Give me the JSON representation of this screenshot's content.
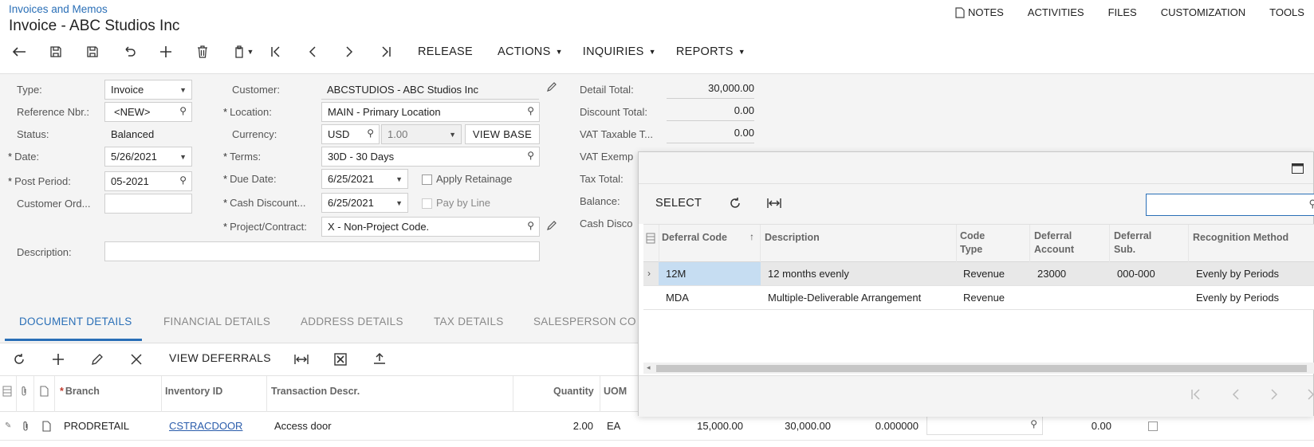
{
  "header": {
    "breadcrumb": "Invoices and Memos",
    "title": "Invoice - ABC Studios Inc",
    "top_links": [
      "NOTES",
      "ACTIVITIES",
      "FILES",
      "CUSTOMIZATION",
      "TOOLS"
    ]
  },
  "toolbar": {
    "release": "RELEASE",
    "actions": "ACTIONS",
    "inquiries": "INQUIRIES",
    "reports": "REPORTS"
  },
  "form": {
    "type_label": "Type:",
    "type_value": "Invoice",
    "ref_label": "Reference Nbr.:",
    "ref_value": "<NEW>",
    "status_label": "Status:",
    "status_value": "Balanced",
    "date_label": "Date:",
    "date_value": "5/26/2021",
    "period_label": "Post Period:",
    "period_value": "05-2021",
    "custord_label": "Customer Ord...",
    "custord_value": "",
    "description_label": "Description:",
    "description_value": "",
    "customer_label": "Customer:",
    "customer_value": "ABCSTUDIOS - ABC Studios Inc",
    "location_label": "Location:",
    "location_value": "MAIN - Primary Location",
    "currency_label": "Currency:",
    "currency_value": "USD",
    "rate_value": "1.00",
    "view_base": "VIEW BASE",
    "terms_label": "Terms:",
    "terms_value": "30D - 30 Days",
    "due_label": "Due Date:",
    "due_value": "6/25/2021",
    "retainage_label": "Apply Retainage",
    "cashdisc_label": "Cash Discount...",
    "cashdisc_value": "6/25/2021",
    "paybyline_label": "Pay by Line",
    "project_label": "Project/Contract:",
    "project_value": "X - Non-Project Code.",
    "detail_total_label": "Detail Total:",
    "detail_total_value": "30,000.00",
    "discount_total_label": "Discount Total:",
    "discount_total_value": "0.00",
    "vat_taxable_label": "VAT Taxable T...",
    "vat_taxable_value": "0.00",
    "vat_exempt_label": "VAT Exemp",
    "tax_total_label": "Tax Total:",
    "balance_label": "Balance:",
    "cash_disc_label": "Cash Disco"
  },
  "tabs": [
    "DOCUMENT DETAILS",
    "FINANCIAL DETAILS",
    "ADDRESS DETAILS",
    "TAX DETAILS",
    "SALESPERSON CO"
  ],
  "grid_toolbar": {
    "view_deferrals": "VIEW DEFERRALS"
  },
  "grid": {
    "headers": [
      "Branch",
      "Inventory ID",
      "Transaction Descr.",
      "Quantity",
      "UOM"
    ],
    "row": {
      "branch": "PRODRETAIL",
      "inventory_id": "CSTRACDOOR",
      "descr": "Access door",
      "quantity": "2.00",
      "uom": "EA",
      "unit_price": "15,000.00",
      "ext_price": "30,000.00",
      "discount": "0.000000",
      "amount": "0.00"
    }
  },
  "popup": {
    "select": "SELECT",
    "search_value": "",
    "headers": {
      "code": "Deferral Code",
      "descr": "Description",
      "type": "Code Type",
      "account": "Deferral Account",
      "sub": "Deferral Sub.",
      "method": "Recognition Method"
    },
    "rows": [
      {
        "code": "12M",
        "descr": "12 months evenly",
        "type": "Revenue",
        "account": "23000",
        "sub": "000-000",
        "method": "Evenly by Periods"
      },
      {
        "code": "MDA",
        "descr": "Multiple-Deliverable Arrangement",
        "type": "Revenue",
        "account": "",
        "sub": "",
        "method": "Evenly by Periods"
      }
    ]
  }
}
